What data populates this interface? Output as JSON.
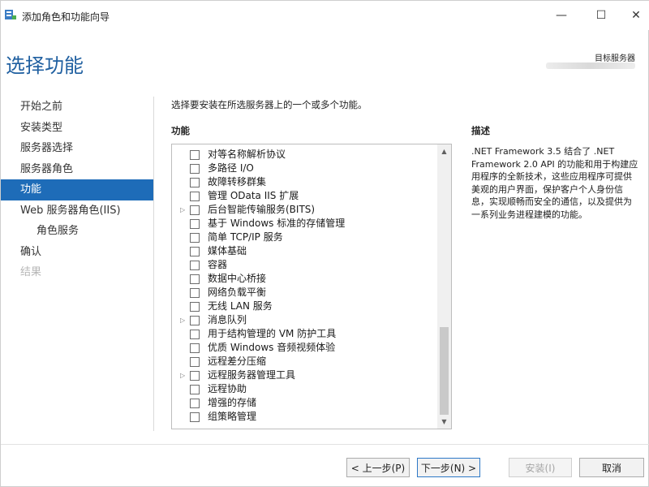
{
  "window": {
    "title": "添加角色和功能向导",
    "minimize_glyph": "—",
    "maximize_glyph": "☐",
    "close_glyph": "✕"
  },
  "header": {
    "page_title": "选择功能",
    "target_server_label": "目标服务器"
  },
  "nav": {
    "items": [
      {
        "label": "开始之前",
        "state": "normal"
      },
      {
        "label": "安装类型",
        "state": "normal"
      },
      {
        "label": "服务器选择",
        "state": "normal"
      },
      {
        "label": "服务器角色",
        "state": "normal"
      },
      {
        "label": "功能",
        "state": "active"
      },
      {
        "label": "Web 服务器角色(IIS)",
        "state": "normal"
      },
      {
        "label": "角色服务",
        "state": "sub"
      },
      {
        "label": "确认",
        "state": "normal"
      },
      {
        "label": "结果",
        "state": "disabled"
      }
    ]
  },
  "content": {
    "instruction": "选择要安装在所选服务器上的一个或多个功能。",
    "features_header": "功能",
    "description_header": "描述",
    "description_text": ".NET Framework 3.5 结合了 .NET Framework 2.0 API 的功能和用于构建应用程序的全新技术，这些应用程序可提供美观的用户界面，保护客户个人身份信息，实现顺畅而安全的通信，以及提供为一系列业务进程建模的功能。",
    "features": [
      {
        "label": "对等名称解析协议",
        "expandable": false,
        "checked": false
      },
      {
        "label": "多路径 I/O",
        "expandable": false,
        "checked": false
      },
      {
        "label": "故障转移群集",
        "expandable": false,
        "checked": false
      },
      {
        "label": "管理 OData IIS 扩展",
        "expandable": false,
        "checked": false
      },
      {
        "label": "后台智能传输服务(BITS)",
        "expandable": true,
        "checked": false
      },
      {
        "label": "基于 Windows 标准的存储管理",
        "expandable": false,
        "checked": false
      },
      {
        "label": "简单 TCP/IP 服务",
        "expandable": false,
        "checked": false
      },
      {
        "label": "媒体基础",
        "expandable": false,
        "checked": false
      },
      {
        "label": "容器",
        "expandable": false,
        "checked": false
      },
      {
        "label": "数据中心桥接",
        "expandable": false,
        "checked": false
      },
      {
        "label": "网络负载平衡",
        "expandable": false,
        "checked": false
      },
      {
        "label": "无线 LAN 服务",
        "expandable": false,
        "checked": false
      },
      {
        "label": "消息队列",
        "expandable": true,
        "checked": false
      },
      {
        "label": "用于结构管理的 VM 防护工具",
        "expandable": false,
        "checked": false
      },
      {
        "label": "优质 Windows 音频视频体验",
        "expandable": false,
        "checked": false
      },
      {
        "label": "远程差分压缩",
        "expandable": false,
        "checked": false
      },
      {
        "label": "远程服务器管理工具",
        "expandable": true,
        "checked": false
      },
      {
        "label": "远程协助",
        "expandable": false,
        "checked": false
      },
      {
        "label": "增强的存储",
        "expandable": false,
        "checked": false
      },
      {
        "label": "组策略管理",
        "expandable": false,
        "checked": false
      }
    ]
  },
  "footer": {
    "prev_label": "< 上一步(P)",
    "next_label": "下一步(N) >",
    "install_label": "安装(I)",
    "cancel_label": "取消"
  },
  "icons": {
    "expander": "▷",
    "scroll_up": "▲",
    "scroll_down": "▼"
  },
  "colors": {
    "accent": "#1e6cb8",
    "title_blue": "#1f5fa0",
    "disabled": "#b6b6b6"
  }
}
